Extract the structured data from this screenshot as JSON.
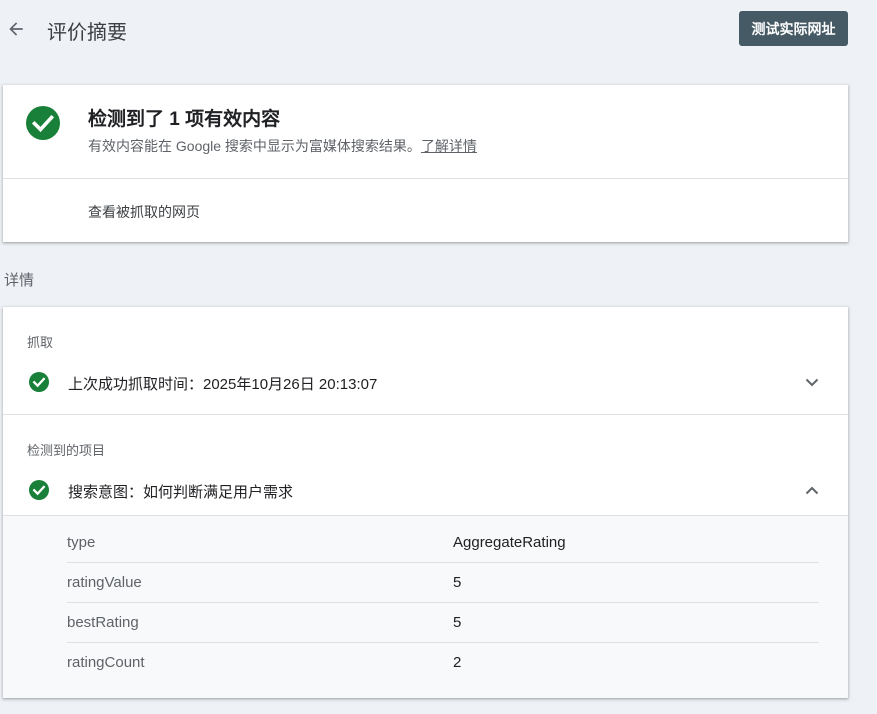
{
  "header": {
    "title": "评价摘要",
    "test_button_label": "测试实际网址"
  },
  "summary": {
    "title": "检测到了 1 项有效内容",
    "description": "有效内容能在 Google 搜索中显示为富媒体搜索结果。",
    "learn_more": "了解详情",
    "view_crawled_page": "查看被抓取的网页"
  },
  "details": {
    "heading": "详情",
    "crawl": {
      "label": "抓取",
      "status": "上次成功抓取时间：2025年10月26日 20:13:07"
    },
    "detected": {
      "label": "检测到的项目",
      "item": "搜索意图：如何判断满足用户需求",
      "properties": [
        {
          "key": "type",
          "value": "AggregateRating"
        },
        {
          "key": "ratingValue",
          "value": "5"
        },
        {
          "key": "bestRating",
          "value": "5"
        },
        {
          "key": "ratingCount",
          "value": "2"
        }
      ]
    }
  },
  "colors": {
    "success_green": "#188038",
    "button_bg": "#455a64",
    "page_bg": "#eef1f6"
  },
  "icons": {
    "back": "arrow-back-icon",
    "valid": "check-circle-icon",
    "collapsed": "chevron-down-icon",
    "expanded": "chevron-up-icon"
  }
}
